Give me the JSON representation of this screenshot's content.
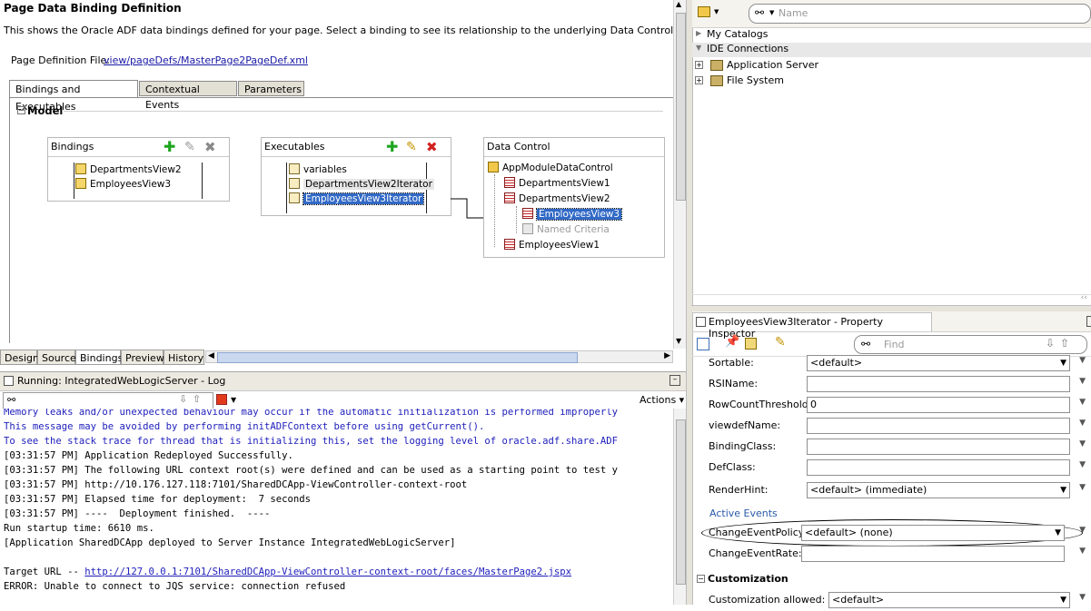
{
  "page": {
    "title": "Page Data Binding Definition",
    "description": "This shows the Oracle ADF data bindings defined for your page. Select a binding to see its relationship to the underlying Data Control.",
    "def_file_label": "Page Definition File:",
    "def_file_link": "view/pageDefs/MasterPage2PageDef.xml"
  },
  "tabs": [
    "Bindings and Executables",
    "Contextual Events",
    "Parameters"
  ],
  "model": {
    "label": "Model",
    "collapse": "−"
  },
  "bindings": {
    "title": "Bindings",
    "items": [
      "DepartmentsView2",
      "EmployeesView3"
    ]
  },
  "executables": {
    "title": "Executables",
    "items": [
      "variables",
      "DepartmentsView2Iterator",
      "EmployeesView3Iterator"
    ]
  },
  "data_control": {
    "title": "Data Control",
    "items": [
      "AppModuleDataControl",
      "DepartmentsView1",
      "DepartmentsView2",
      "EmployeesView3",
      "Named Criteria",
      "EmployeesView1"
    ]
  },
  "editor_tabs": [
    "Design",
    "Source",
    "Bindings",
    "Preview",
    "History"
  ],
  "log": {
    "title": "Running: IntegratedWebLogicServer - Log",
    "actions": "Actions ▾",
    "lines": [
      "Memory leaks and/or unexpected behaviour may occur if the automatic initialization is performed improperly",
      "This message may be avoided by performing initADFContext before using getCurrent().",
      "To see the stack trace for thread that is initializing this, set the logging level of oracle.adf.share.ADF",
      "[03:31:57 PM] Application Redeployed Successfully.",
      "[03:31:57 PM] The following URL context root(s) were defined and can be used as a starting point to test y",
      "[03:31:57 PM] http://10.176.127.118:7101/SharedDCApp-ViewController-context-root",
      "[03:31:57 PM] Elapsed time for deployment:  7 seconds",
      "[03:31:57 PM] ----  Deployment finished.  ----",
      "Run startup time: 6610 ms.",
      "[Application SharedDCApp deployed to Server Instance IntegratedWebLogicServer]",
      "",
      "Target URL -- ",
      "ERROR: Unable to connect to JQS service: connection refused"
    ],
    "target_url": "http://127.0.0.1:7101/SharedDCApp-ViewController-context-root/faces/MasterPage2.jspx"
  },
  "resource_palette": {
    "search_placeholder": "Name",
    "my_catalogs": "My Catalogs",
    "ide_connections": "IDE Connections",
    "app_server": "Application Server",
    "file_system": "File System"
  },
  "inspector": {
    "title": "EmployeesView3Iterator - Property Inspector",
    "find_placeholder": "Find",
    "rows": [
      {
        "label": "Sortable:",
        "value": "<default>",
        "dropdown": true
      },
      {
        "label": "RSIName:",
        "value": "",
        "dropdown": false
      },
      {
        "label": "RowCountThreshold:",
        "value": "0",
        "dropdown": false
      },
      {
        "label": "viewdefName:",
        "value": "",
        "dropdown": false
      },
      {
        "label": "BindingClass:",
        "value": "",
        "dropdown": false
      },
      {
        "label": "DefClass:",
        "value": "",
        "dropdown": false
      },
      {
        "label": "RenderHint:",
        "value": "<default> (immediate)",
        "dropdown": true
      }
    ],
    "active_events": "Active Events",
    "change_event_policy_label": "ChangeEventPolicy:",
    "change_event_policy_value": "<default> (none)",
    "change_event_rate_label": "ChangeEventRate:",
    "customization": "Customization",
    "customization_allowed_label": "Customization allowed:",
    "customization_allowed_value": "<default>"
  },
  "colors": {
    "selection": "#3169c6",
    "link": "#1a1aa6",
    "log_blue": "#1d1dbb",
    "add_green": "#1fa51f",
    "delete_red": "#d21f1f"
  }
}
